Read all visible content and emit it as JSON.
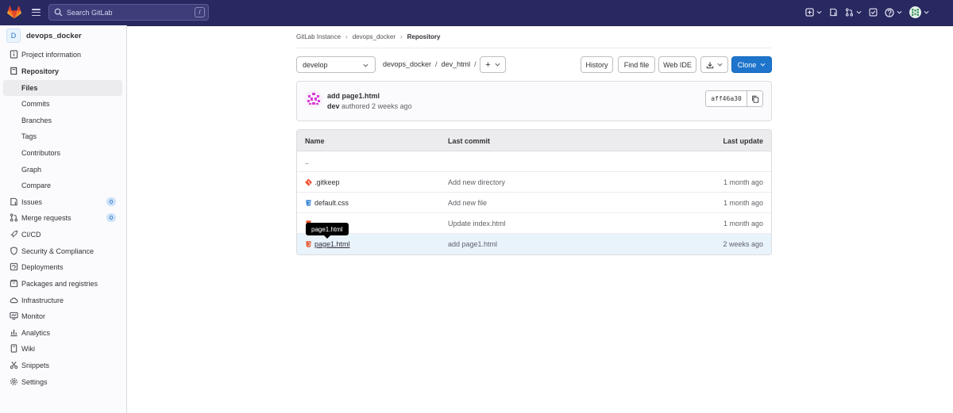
{
  "topbar": {
    "search_placeholder": "Search GitLab",
    "search_shortcut": "/",
    "brand_color": "#292961"
  },
  "sidebar": {
    "project_initial": "D",
    "project_name": "devops_docker",
    "items": [
      {
        "label": "Project information",
        "icon": "info-icon"
      },
      {
        "label": "Repository",
        "icon": "book-icon"
      },
      {
        "label": "Files",
        "active": true
      },
      {
        "label": "Commits"
      },
      {
        "label": "Branches"
      },
      {
        "label": "Tags"
      },
      {
        "label": "Contributors"
      },
      {
        "label": "Graph"
      },
      {
        "label": "Compare"
      },
      {
        "label": "Issues",
        "icon": "issues-icon",
        "badge": "0"
      },
      {
        "label": "Merge requests",
        "icon": "merge-request-icon",
        "badge": "0"
      },
      {
        "label": "CI/CD",
        "icon": "rocket-icon"
      },
      {
        "label": "Security & Compliance",
        "icon": "shield-icon"
      },
      {
        "label": "Deployments",
        "icon": "deployments-icon"
      },
      {
        "label": "Packages and registries",
        "icon": "package-icon"
      },
      {
        "label": "Infrastructure",
        "icon": "cloud-icon"
      },
      {
        "label": "Monitor",
        "icon": "monitor-icon"
      },
      {
        "label": "Analytics",
        "icon": "chart-icon"
      },
      {
        "label": "Wiki",
        "icon": "wiki-icon"
      },
      {
        "label": "Snippets",
        "icon": "snippet-icon"
      },
      {
        "label": "Settings",
        "icon": "gear-icon"
      }
    ]
  },
  "breadcrumb": {
    "items": [
      "GitLab Instance",
      "devops_docker",
      "Repository"
    ]
  },
  "toolbar": {
    "branch": "develop",
    "path": [
      "devops_docker",
      "dev_html"
    ],
    "path_sep": "/",
    "plus": "+",
    "history": "History",
    "find_file": "Find file",
    "web_ide": "Web IDE",
    "clone": "Clone",
    "primary_color": "#1f75cb"
  },
  "last_commit": {
    "title": "add page1.html",
    "author": "dev",
    "meta": "authored 2 weeks ago",
    "sha": "aff46a30"
  },
  "files": {
    "headers": {
      "name": "Name",
      "last_commit": "Last commit",
      "last_update": "Last update"
    },
    "rows": [
      {
        "name": "..",
        "commit": "",
        "update": ""
      },
      {
        "name": ".gitkeep",
        "icon": "gitkeep-icon",
        "commit": "Add new directory",
        "update": "1 month ago"
      },
      {
        "name": "default.css",
        "icon": "css-file-icon",
        "commit": "Add new file",
        "update": "1 month ago"
      },
      {
        "name": "",
        "icon": "html-file-icon",
        "commit": "Update index.html",
        "update": "1 month ago"
      },
      {
        "name": "page1.html",
        "icon": "html-file-icon",
        "commit": "add page1.html",
        "update": "2 weeks ago"
      }
    ]
  },
  "tooltip": {
    "text": "page1.html"
  }
}
